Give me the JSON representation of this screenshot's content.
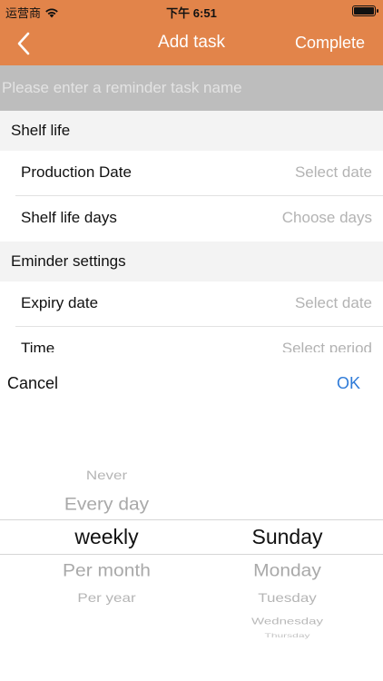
{
  "status_bar": {
    "carrier": "运营商",
    "time": "下午 6:51"
  },
  "nav": {
    "title": "Add task",
    "complete_label": "Complete"
  },
  "task_name": {
    "placeholder": "Please enter a reminder task name",
    "value": ""
  },
  "shelf_life": {
    "header": "Shelf life",
    "production_date": {
      "label": "Production Date",
      "value": "Select date"
    },
    "shelf_life_days": {
      "label": "Shelf life days",
      "value": "Choose days"
    }
  },
  "reminder": {
    "header": "Eminder settings",
    "expiry_date": {
      "label": "Expiry date",
      "value": "Select date"
    },
    "time": {
      "label": "Time",
      "value": "Select period"
    }
  },
  "picker": {
    "cancel_label": "Cancel",
    "ok_label": "OK",
    "period_options": [
      "Never",
      "Every day",
      "weekly",
      "Per month",
      "Per year"
    ],
    "period_selected": "weekly",
    "day_options": [
      "Sunday",
      "Monday",
      "Tuesday",
      "Wednesday",
      "Thursday"
    ],
    "day_selected": "Sunday"
  },
  "colors": {
    "nav_background": "#e2844a",
    "ok_button": "#2f7bd8",
    "input_background": "#bdbdbd"
  }
}
